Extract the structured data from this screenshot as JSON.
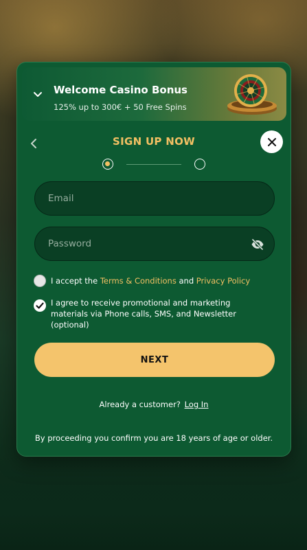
{
  "bonus": {
    "title": "Welcome Casino Bonus",
    "subtitle": "125% up to 300€ + 50 Free Spins"
  },
  "form": {
    "title": "SIGN UP NOW",
    "email_placeholder": "Email",
    "password_placeholder": "Password",
    "steps": {
      "current": 1,
      "total": 2
    },
    "terms": {
      "prefix": "I accept the ",
      "terms_link": "Terms & Conditions",
      "and": " and ",
      "privacy_link": "Privacy Policy",
      "checked": false
    },
    "marketing": {
      "text": "I agree to receive promotional and marketing materials via Phone calls, SMS, and Newsletter (optional)",
      "checked": true
    },
    "next_label": "NEXT",
    "already_customer": "Already a customer?",
    "login_label": "Log In",
    "age_note": "By proceeding you confirm you are 18 years of age or older."
  },
  "colors": {
    "modal_bg": "#0d5a32",
    "accent_gold": "#f2c063",
    "button_gold": "#f4c46c",
    "field_bg": "#0a3f24"
  },
  "icons": {
    "bonus_toggle": "chevron-down-icon",
    "back": "chevron-left-icon",
    "close": "close-icon",
    "password_visibility": "eye-slash-icon",
    "bonus_image": "roulette-wheel-icon"
  }
}
